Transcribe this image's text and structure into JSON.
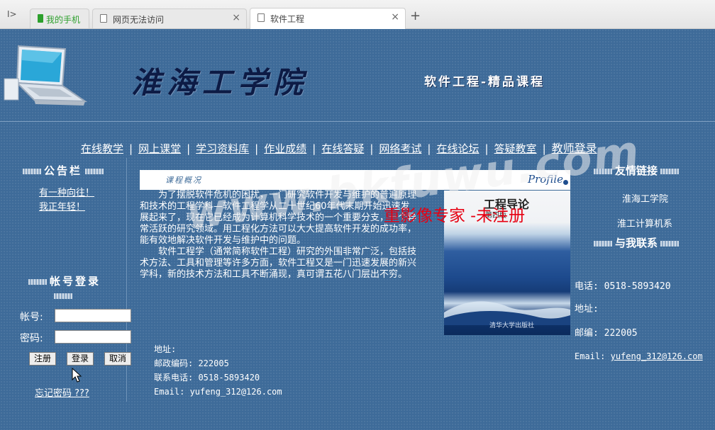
{
  "browser": {
    "tabs": [
      {
        "label": "我的手机",
        "icon": "phone-icon",
        "active": false
      },
      {
        "label": "网页无法访问",
        "icon": "page-icon",
        "active": false
      },
      {
        "label": "软件工程",
        "icon": "page-icon",
        "active": true
      }
    ],
    "sidebar_toggle": "I>",
    "close_glyph": "×",
    "new_tab": "+"
  },
  "banner": {
    "school_name": "淮海工学院",
    "course_name": "软件工程-精品课程"
  },
  "nav": {
    "items": [
      "在线教学",
      "网上课堂",
      "学习资料库",
      "作业成绩",
      "在线答疑",
      "网络考试",
      "在线论坛",
      "答疑教室"
    ],
    "separator": "|",
    "teacher_login": "教师登录"
  },
  "left": {
    "notice_title": "公告栏",
    "notices": [
      "有一种向往！",
      "我正年轻！"
    ],
    "login_title": "帐号登录",
    "account_label": "帐号:",
    "password_label": "密码:",
    "register_btn": "注册",
    "login_btn": "登录",
    "cancel_btn": "取消",
    "forgot_link": "忘记密码 ???"
  },
  "main": {
    "section_title": "课程概况",
    "profile_label": "Profile",
    "intro_p1": "为了摆脱软件危机的困扰，一门研究软件开发与维护的普遍原理和技术的工程学科—软件工程学从二十世纪60年代末期开始迅速发展起来了，现在它已经成为计算机科学技术的一个重要分支，一个异常活跃的研究领域。用工程化方法可以大大提高软件开发的成功率，能有效地解决软件开发与维护中的问题。",
    "intro_p2": "软件工程学（通常简称软件工程）研究的外围非常广泛，包括技术方法、工具和管理等许多方面，软件工程又是一门迅速发展的新兴学科，新的技术方法和工具不断涌现，真可谓五花八门层出不穷。",
    "book_title": "工程导论",
    "book_sub": "第四版",
    "book_publisher": "清华大学出版社",
    "watermark": "www.bkfuwu.com",
    "registration_overlay": "重影像专家 -未注册"
  },
  "contact": {
    "address_label": "地址:",
    "postcode": "邮政编码: 222005",
    "phone": "联系电话: 0518-5893420",
    "email": "Email: yufeng_312@126.com"
  },
  "right": {
    "links_title": "友情链接",
    "links": [
      "淮海工学院",
      "淮工计算机系"
    ],
    "contact_title": "与我联系",
    "phone": "电话: 0518-5893420",
    "address": "地址:",
    "postcode": "邮编: 222005",
    "email_label": "Email:",
    "email": "yufeng_312@126.com"
  },
  "colors": {
    "page_bg": "#3e6b99",
    "title_text": "#0d1b45",
    "registration_red": "#e60012"
  }
}
